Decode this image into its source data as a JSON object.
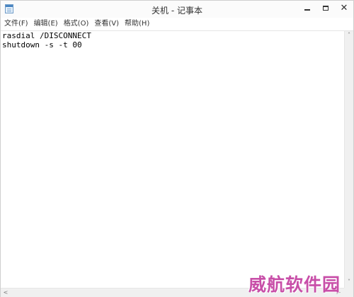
{
  "window": {
    "title": "关机 - 记事本"
  },
  "titlebar": {
    "icon": "notepad-icon",
    "close_glyph": "✕"
  },
  "menu": {
    "items": [
      {
        "label": "文件(F)"
      },
      {
        "label": "编辑(E)"
      },
      {
        "label": "格式(O)"
      },
      {
        "label": "查看(V)"
      },
      {
        "label": "帮助(H)"
      }
    ]
  },
  "editor": {
    "lines": [
      "rasdial /DISCONNECT",
      "shutdown -s -t 00"
    ]
  },
  "scrollbars": {
    "up": "˄",
    "down": "˅",
    "left": "<",
    "right": ">"
  },
  "watermark": {
    "text": "威航软件园",
    "color": "#c84fa8"
  }
}
